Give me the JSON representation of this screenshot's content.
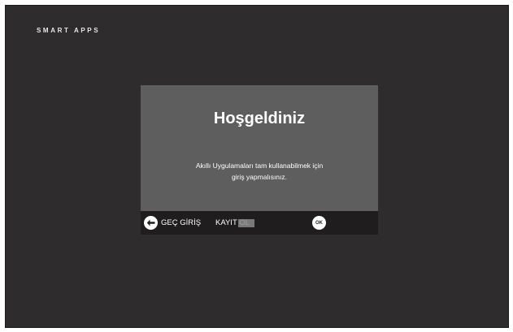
{
  "header": {
    "app_title": "SMART APPS"
  },
  "dialog": {
    "title": "Hoşgeldiniz",
    "message_line1": "Akıllı Uygulamaları tam kullanabilmek için",
    "message_line2": "giriş yapmalısınız."
  },
  "bottom_bar": {
    "skip_label": "GEÇ GİRİŞ",
    "skip_icon": "arrow-left-icon",
    "register_label": "KAYIT OL",
    "ok_icon_label": "OK"
  },
  "colors": {
    "screen_bg": "#2f2c2d",
    "dialog_bg": "#5f5e5f",
    "bar_bg": "#1f1d1e",
    "text": "#ffffff"
  }
}
